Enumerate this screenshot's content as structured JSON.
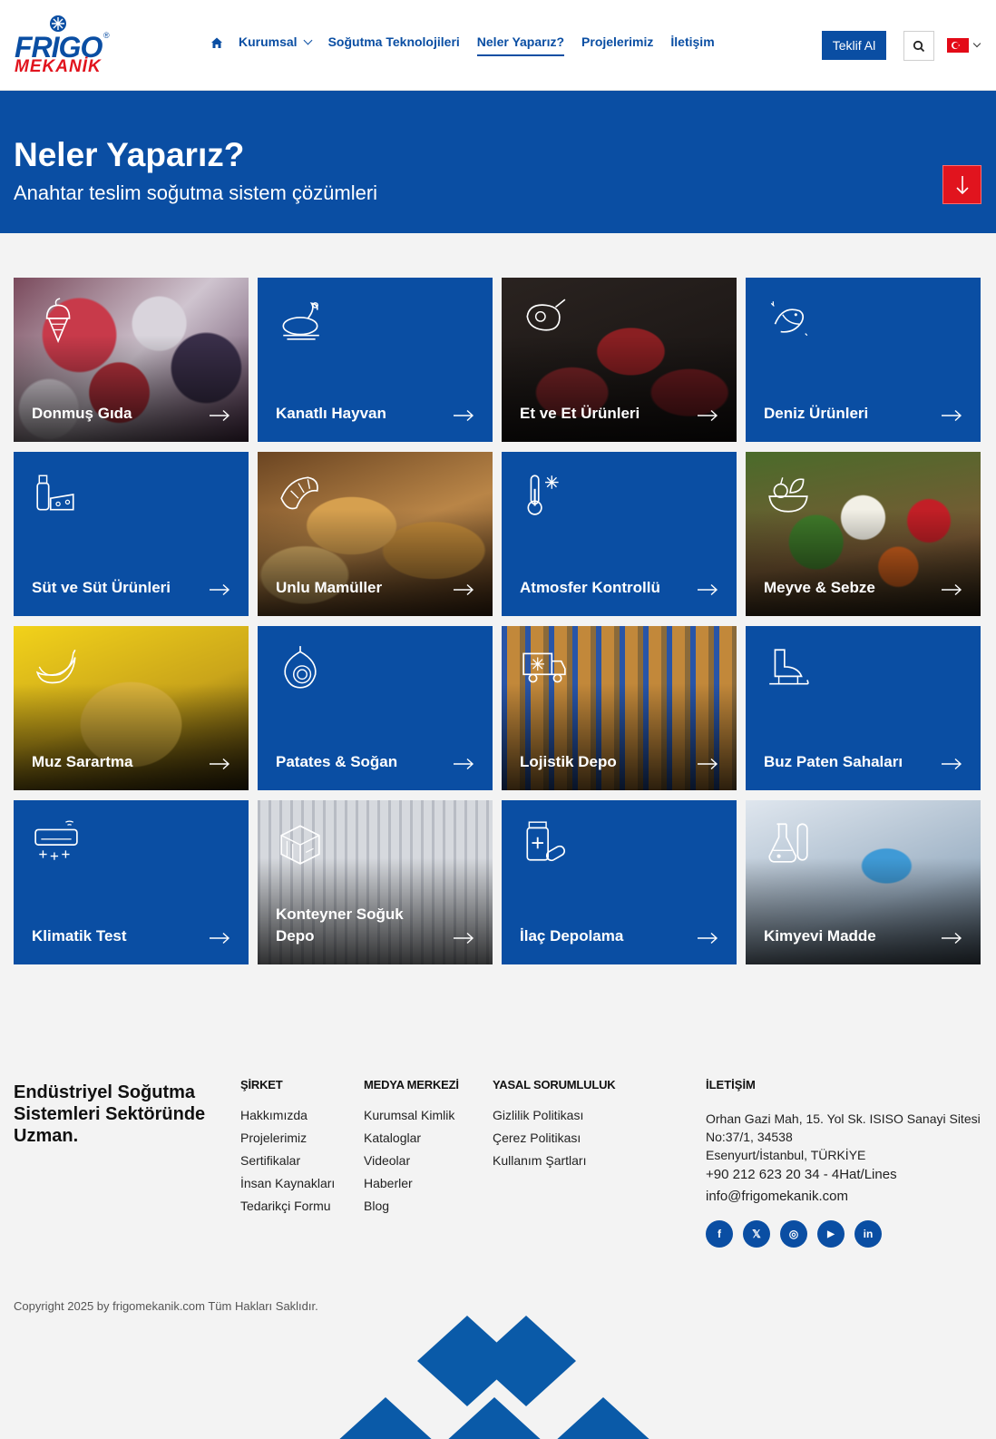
{
  "brand": {
    "name_top": "FRIGO",
    "name_bottom": "MEKANİK",
    "reg": "®",
    "primary_color": "#0a4ea3",
    "accent_color": "#e1141e"
  },
  "nav": {
    "items": [
      {
        "label": "Kurumsal",
        "dropdown": true
      },
      {
        "label": "Soğutma Teknolojileri"
      },
      {
        "label": "Neler Yaparız?",
        "active": true
      },
      {
        "label": "Projelerimiz"
      },
      {
        "label": "İletişim"
      }
    ],
    "cta_label": "Teklif Al",
    "language": "tr"
  },
  "hero": {
    "title": "Neler Yaparız?",
    "subtitle": "Anahtar teslim soğutma sistem çözümleri"
  },
  "cards": [
    {
      "label": "Donmuş Gıda",
      "icon": "ice-cream-icon",
      "photo": true,
      "theme": "berries"
    },
    {
      "label": "Kanatlı Hayvan",
      "icon": "chicken-icon",
      "photo": false
    },
    {
      "label": "Et ve Et Ürünleri",
      "icon": "steak-icon",
      "photo": true,
      "theme": "meat"
    },
    {
      "label": "Deniz Ürünleri",
      "icon": "fish-icon",
      "photo": false
    },
    {
      "label": "Süt ve Süt Ürünleri",
      "icon": "dairy-icon",
      "photo": false
    },
    {
      "label": "Unlu Mamüller",
      "icon": "croissant-icon",
      "photo": true,
      "theme": "bread"
    },
    {
      "label": "Atmosfer Kontrollü",
      "icon": "thermometer-snow-icon",
      "photo": false
    },
    {
      "label": "Meyve & Sebze",
      "icon": "fruit-basket-icon",
      "photo": true,
      "theme": "vegetables"
    },
    {
      "label": "Muz Sarartma",
      "icon": "banana-icon",
      "photo": true,
      "theme": "banana"
    },
    {
      "label": "Patates & Soğan",
      "icon": "onion-icon",
      "photo": false
    },
    {
      "label": "Lojistik Depo",
      "icon": "reefer-truck-icon",
      "photo": true,
      "theme": "warehouse"
    },
    {
      "label": "Buz Paten Sahaları",
      "icon": "ice-skate-icon",
      "photo": false
    },
    {
      "label": "Klimatik Test",
      "icon": "air-conditioner-icon",
      "photo": false
    },
    {
      "label": "Konteyner Soğuk Depo",
      "icon": "container-icon",
      "photo": true,
      "theme": "container"
    },
    {
      "label": "İlaç Depolama",
      "icon": "medicine-icon",
      "photo": false
    },
    {
      "label": "Kimyevi Madde",
      "icon": "flask-icon",
      "photo": true,
      "theme": "lab"
    }
  ],
  "footer": {
    "tagline": "Endüstriyel Soğutma Sistemleri Sektöründe Uzman.",
    "columns": [
      {
        "title": "ŞİRKET",
        "links": [
          "Hakkımızda",
          "Projelerimiz",
          "Sertifikalar",
          "İnsan Kaynakları",
          "Tedarikçi Formu"
        ]
      },
      {
        "title": "MEDYA MERKEZİ",
        "links": [
          "Kurumsal Kimlik",
          "Kataloglar",
          "Videolar",
          "Haberler",
          "Blog"
        ]
      },
      {
        "title": "YASAL SORUMLULUK",
        "links": [
          "Gizlilik Politikası",
          "Çerez Politikası",
          "Kullanım Şartları"
        ]
      }
    ],
    "contact": {
      "title": "İLETİŞİM",
      "address_line1": "Orhan Gazi Mah, 15. Yol Sk. ISISO Sanayi Sitesi No:37/1, 34538",
      "address_line2": "Esenyurt/İstanbul, TÜRKİYE",
      "phone": "+90 212 623 20 34 - 4Hat/Lines",
      "email": "info@frigomekanik.com"
    },
    "socials": [
      {
        "name": "facebook",
        "glyph": "f"
      },
      {
        "name": "x",
        "glyph": "𝕏"
      },
      {
        "name": "instagram",
        "glyph": "◎"
      },
      {
        "name": "youtube",
        "glyph": "▶"
      },
      {
        "name": "linkedin",
        "glyph": "in"
      }
    ],
    "copyright": "Copyright 2025 by frigomekanik.com Tüm Hakları Saklıdır."
  }
}
